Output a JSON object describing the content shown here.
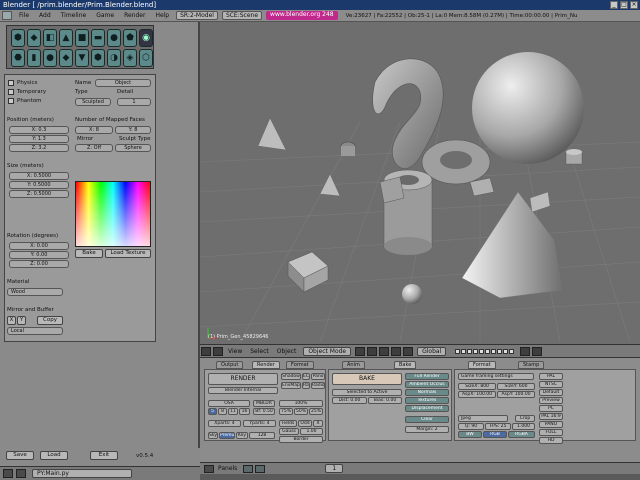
{
  "window": {
    "title": "Blender [         /prim.blender/Prim.Blender.blend]",
    "controls": [
      "_",
      "□",
      "×"
    ]
  },
  "menubar": {
    "items": [
      "File",
      "Add",
      "Timeline",
      "Game",
      "Render",
      "Help"
    ],
    "screen": "SR:2-Model",
    "scene": "SCE:Scene",
    "url": "www.blender.org 248",
    "stats": "Ve:23627 | Fa:22552 | Ob:25-1 | La:0   Mem:8.58M (0.27M)  | Time:00:00.00 | Prim_Nu"
  },
  "tools": [
    "⬢",
    "◆",
    "◧",
    "▲",
    "■",
    "▬",
    "●",
    "⬟",
    "◉",
    "⬣",
    "▮",
    "●",
    "◆",
    "▼",
    "⬢",
    "◑",
    "◈",
    "⬡"
  ],
  "props": {
    "physics": "Physics",
    "temporary": "Temporary",
    "phantom": "Phantom",
    "name_label": "Name",
    "name_value": "Object",
    "type_label": "Type",
    "type_value": "Sculpted",
    "detail_label": "Detail",
    "detail_value": "1",
    "position_label": "Position (meters)",
    "pos_x": "X: 0.3",
    "pos_y": "Y: 1.3",
    "pos_z": "Z: 3.2",
    "faces_label": "Number of Mapped Faces",
    "faces_x": "X: 8",
    "faces_y": "Y: 8",
    "mirror_label": "Mirror",
    "mirror_value": "Z: Off",
    "sculpt_type_label": "Sculpt Type",
    "sculpt_type_value": "Sphere",
    "size_label": "Size (meters)",
    "size_x": "X: 0.5000",
    "size_y": "Y: 0.5000",
    "size_z": "Z: 0.5000",
    "bake": "Bake",
    "load_texture": "Load Texture",
    "rotation_label": "Rotation (degrees)",
    "rot_x": "X: 0.00",
    "rot_y": "Y: 0.00",
    "rot_z": "Z: 0.00",
    "material_label": "Material",
    "material_value": "Wood",
    "mirror_buffer_label": "Mirror and Buffer",
    "mb_x": "X",
    "mb_y": "Y",
    "copy": "Copy",
    "local_value": "Local"
  },
  "leftbottom": {
    "save": "Save",
    "load": "Load",
    "exit": "Exit",
    "version": "v0.5.4"
  },
  "status": {
    "script": "PY:Main.py"
  },
  "viewport": {
    "label": "(1) Prim_Gen_45829646"
  },
  "vpheader": {
    "view": "View",
    "select": "Select",
    "object": "Object",
    "mode": "Object Mode",
    "global": "Global"
  },
  "buttons": {
    "tabs": [
      "Output",
      "Render",
      "Format",
      "Anim",
      "Bake",
      "Format",
      "Stamp"
    ],
    "render_btn": "RENDER",
    "engine": "Blender Internal",
    "shadow": "Shadow",
    "ec": "EC",
    "pano": "Pano",
    "envmap": "EnvMap",
    "ray": "Ray",
    "radio": "Radio",
    "osa": "OSA",
    "mblur": "MBLUR",
    "pct100": "100%",
    "osa_values": [
      "5",
      "8",
      "11",
      "16"
    ],
    "bf": "Bf: 0.50",
    "pct75": "75%",
    "pct50": "50%",
    "pct25": "25%",
    "xparts": "Xparts: 4",
    "yparts": "Yparts: 4",
    "fields": "Fields",
    "odd": "Odd",
    "x": "X",
    "gauss": "Gauss",
    "gauss_val": "1.00",
    "sky": "Sky",
    "premul": "Premul",
    "key": "Key",
    "bits": "128",
    "border": "Border",
    "bake_btn": "BAKE",
    "selected_active": "Selected to Active",
    "dist": "Dist: 0.00",
    "bias": "Bias: 0.00",
    "full_render": "Full Render",
    "ambient_occ": "Ambient Occlus",
    "normals": "Normals",
    "textures": "Textures",
    "displacement": "Displacement",
    "clear": "Clear",
    "margin": "Margin: 2",
    "game_framing": "Game framing settings",
    "sizex": "SizeX: 800",
    "sizey": "SizeY: 600",
    "aspx": "AspX: 100.00",
    "aspy": "AspY: 100.00",
    "jpeg": "Jpeg",
    "crop": "Crop",
    "q": "Q: 90",
    "fps": "FPS: 25",
    "fps2": "1.000",
    "bw": "BW",
    "rgb": "RGB",
    "rgba": "RGBA",
    "presets": [
      "PAL",
      "NTSC",
      "Default",
      "Preview",
      "PC",
      "PAL 16:9",
      "PANO",
      "FULL",
      "HD"
    ]
  },
  "btnhdr": {
    "panels": "Panels",
    "frame": "1"
  }
}
